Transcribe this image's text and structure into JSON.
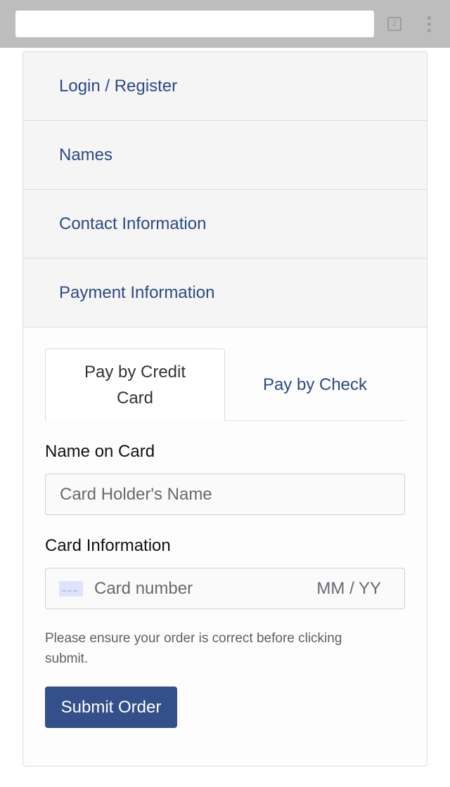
{
  "browser": {
    "tab_count": "2"
  },
  "sections": {
    "login": "Login / Register",
    "names": "Names",
    "contact": "Contact Information",
    "payment": "Payment Information"
  },
  "payment": {
    "tabs": {
      "credit": "Pay by Credit Card",
      "check": "Pay by Check"
    },
    "active_tab": "credit",
    "name_label": "Name on Card",
    "name_placeholder": "Card Holder's Name",
    "card_label": "Card Information",
    "card_number_placeholder": "Card number",
    "card_expiry_placeholder": "MM / YY",
    "notice": "Please ensure your order is correct before clicking submit.",
    "submit_label": "Submit Order"
  },
  "colors": {
    "link": "#2c4a86",
    "button": "#33508a",
    "chrome": "#bdbdbd"
  },
  "icons": {
    "card": "credit-card-icon",
    "menu": "vertical-dots-icon"
  }
}
